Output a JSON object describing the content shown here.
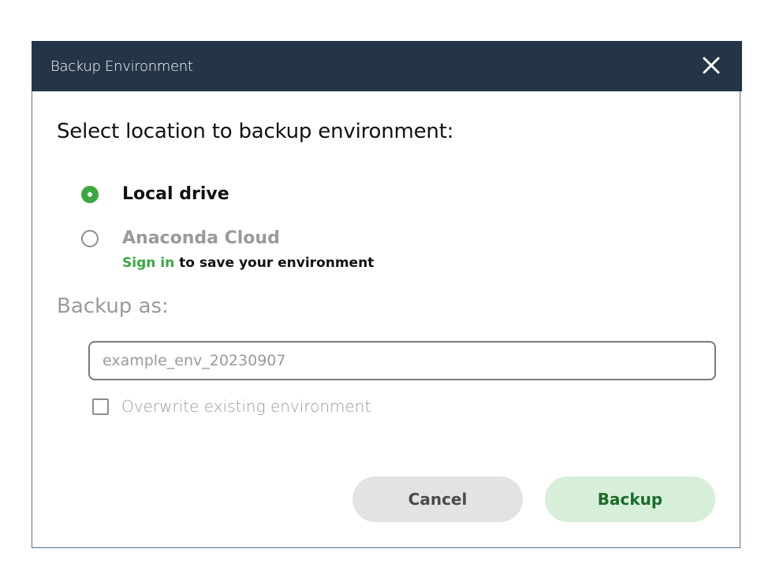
{
  "dialog": {
    "title": "Backup Environment",
    "close_icon": "close-icon",
    "heading": "Select location to backup environment:",
    "options": [
      {
        "label": "Local drive",
        "selected": true
      },
      {
        "label": "Anaconda Cloud",
        "selected": false
      }
    ],
    "signin": {
      "link_text": "Sign in",
      "rest_text": " to save your environment"
    },
    "backup_as_label": "Backup as:",
    "name_input": {
      "value": "",
      "placeholder": "example_env_20230907"
    },
    "overwrite": {
      "label": "Overwrite existing environment",
      "checked": false
    },
    "buttons": {
      "cancel_label": "Cancel",
      "backup_label": "Backup"
    }
  },
  "colors": {
    "titlebar": "#243547",
    "accent_green": "#3aa83f",
    "backup_button_bg": "#d7efd9",
    "backup_button_text": "#1a6d2a",
    "cancel_button_bg": "#e3e3e3"
  }
}
